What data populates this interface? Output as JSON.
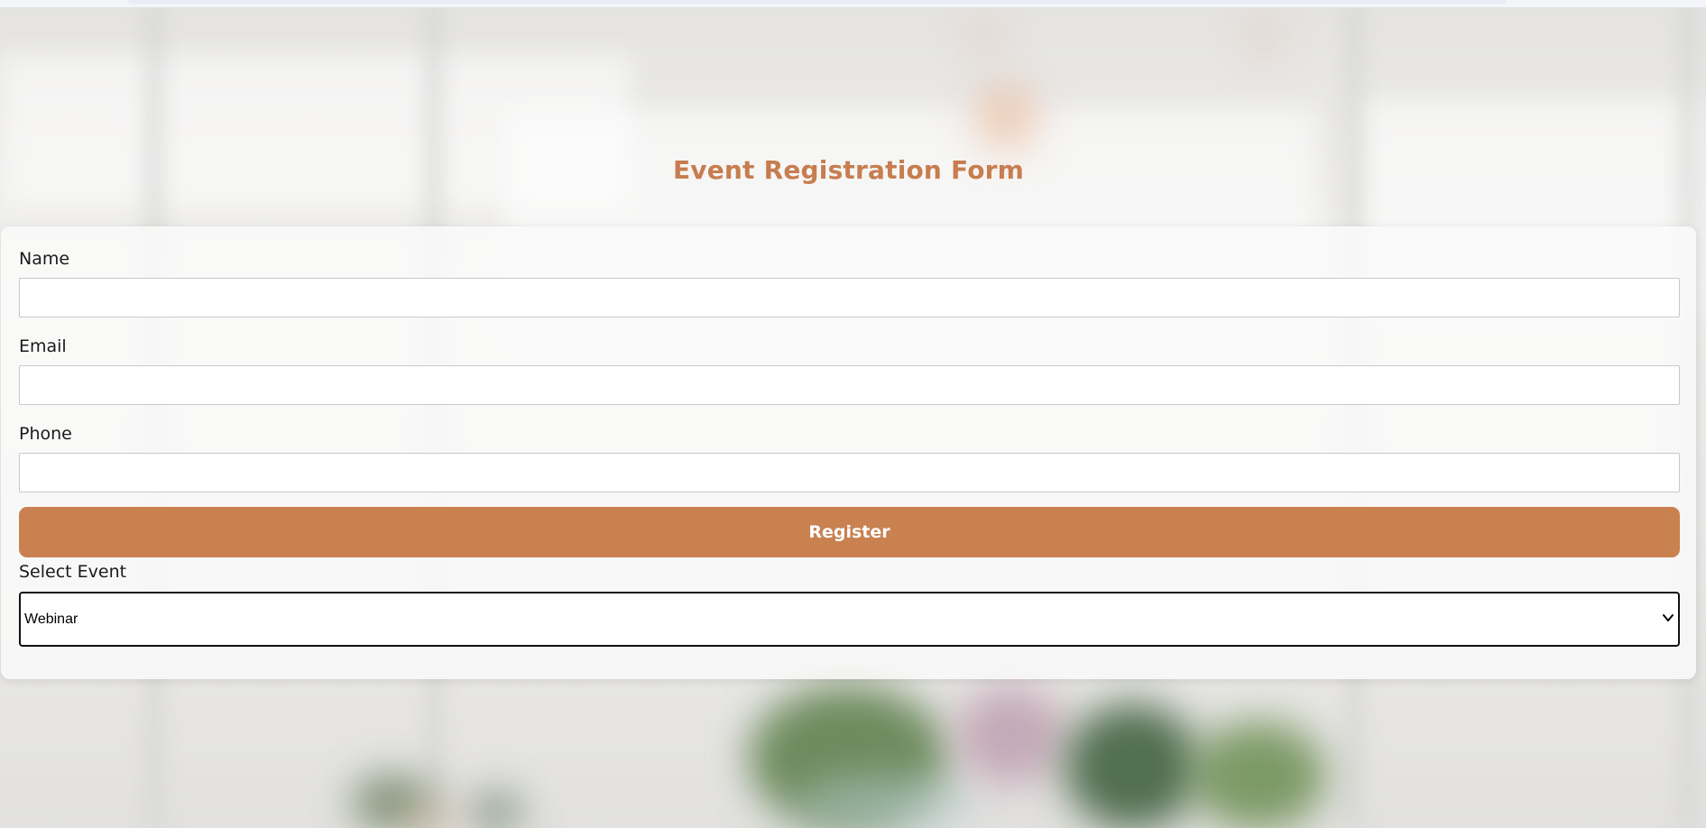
{
  "page": {
    "title": "Event Registration Form"
  },
  "form": {
    "name_label": "Name",
    "name_value": "",
    "email_label": "Email",
    "email_value": "",
    "phone_label": "Phone",
    "phone_value": "",
    "register_label": "Register",
    "event_label": "Select Event",
    "event_selected": "Webinar"
  },
  "icons": {
    "select_chevron": "chevron-down-icon"
  },
  "colors": {
    "accent": "#c98150",
    "title": "#c77d4f"
  }
}
